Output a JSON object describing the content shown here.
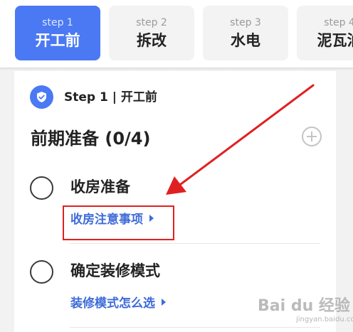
{
  "steps": [
    {
      "num": "step 1",
      "name": "开工前",
      "active": true
    },
    {
      "num": "step 2",
      "name": "拆改",
      "active": false
    },
    {
      "num": "step 3",
      "name": "水电",
      "active": false
    },
    {
      "num": "step 4",
      "name": "泥瓦油",
      "active": false
    }
  ],
  "card": {
    "step_label": "Step 1 | 开工前",
    "section_title": "前期准备 (0/4)",
    "tasks": [
      {
        "name": "收房准备",
        "link": "收房注意事项"
      },
      {
        "name": "确定装修模式",
        "link": "装修模式怎么选"
      }
    ]
  },
  "watermark": {
    "text": "Bai du 经验",
    "url": "jingyan.baidu.com"
  },
  "colors": {
    "accent": "#4a79f3",
    "link": "#3e6bd8",
    "annotation": "#e02020"
  }
}
